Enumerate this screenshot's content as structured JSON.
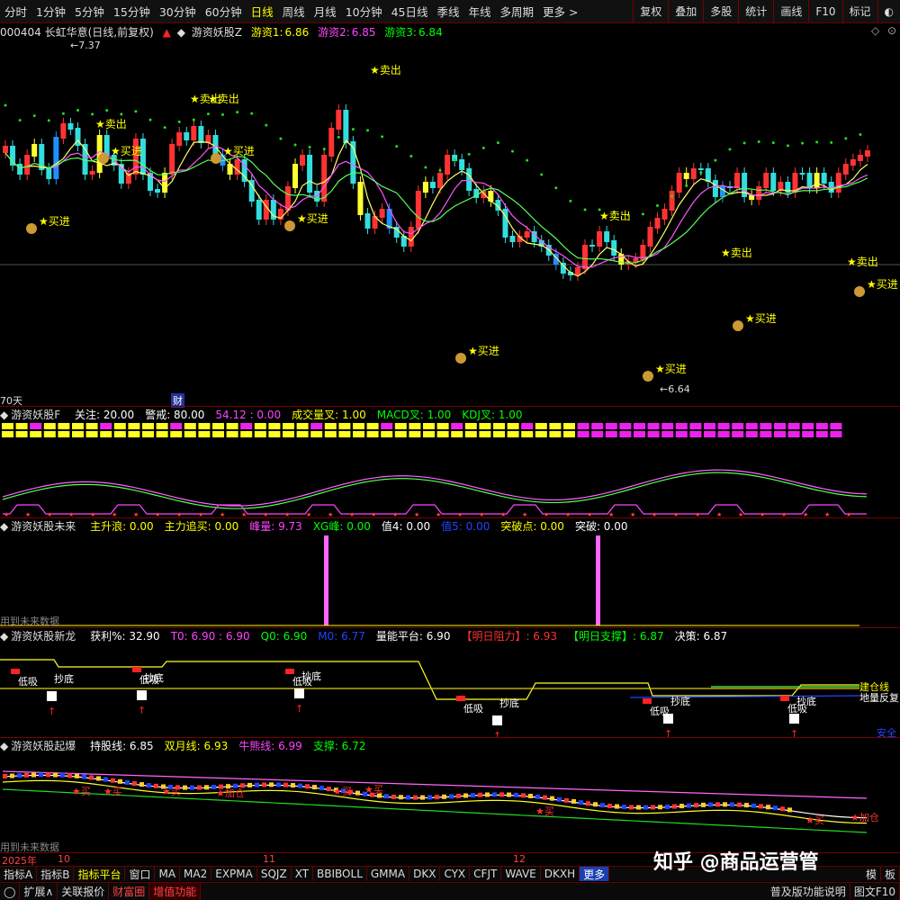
{
  "toolbar": {
    "periods": [
      "分时",
      "1分钟",
      "5分钟",
      "15分钟",
      "30分钟",
      "60分钟",
      "日线",
      "周线",
      "月线",
      "10分钟",
      "45日线",
      "季线",
      "年线",
      "多周期",
      "更多 >"
    ],
    "active_index": 6,
    "right": [
      "复权",
      "叠加",
      "多股",
      "统计",
      "画线",
      "F10",
      "标记",
      "◐"
    ]
  },
  "stock": {
    "title": "000404 长虹华意(日线,前复权)",
    "indicator": "游资妖股Z",
    "v1_label": "游资1:",
    "v1": "6.86",
    "v2_label": "游资2:",
    "v2": "6.85",
    "v3_label": "游资3:",
    "v3": "6.84",
    "high": "7.37",
    "low": "6.64",
    "days": "70天",
    "cai": "财"
  },
  "signals": {
    "sell": "卖出",
    "buy": "买进"
  },
  "panel2": {
    "name": "游资妖股F",
    "items": [
      {
        "t": "关注: 20.00",
        "c": "#ffffff"
      },
      {
        "t": "警戒: 80.00",
        "c": "#ffffff"
      },
      {
        "t": "54.12 : 0.00",
        "c": "#ff44ff"
      },
      {
        "t": "成交量叉: 1.00",
        "c": "#ffff00"
      },
      {
        "t": "MACD叉: 1.00",
        "c": "#00ff00"
      },
      {
        "t": "KDJ叉: 1.00",
        "c": "#00ff00"
      }
    ]
  },
  "panel3": {
    "name": "游资妖股未来",
    "items": [
      {
        "t": "主升浪: 0.00",
        "c": "#ffff00"
      },
      {
        "t": "主力追买: 0.00",
        "c": "#ffff00"
      },
      {
        "t": "峰量: 9.73",
        "c": "#ff44ff"
      },
      {
        "t": "XG峰: 0.00",
        "c": "#00ff00"
      },
      {
        "t": "值4: 0.00",
        "c": "#ffffff"
      },
      {
        "t": "值5: 0.00",
        "c": "#2244ff"
      },
      {
        "t": "突破点: 0.00",
        "c": "#ffff00"
      },
      {
        "t": "突破: 0.00",
        "c": "#ffffff"
      }
    ],
    "future": "用到未来数据"
  },
  "panel4": {
    "name": "游资妖股新龙",
    "items": [
      {
        "t": "获利%: 32.90",
        "c": "#ffffff"
      },
      {
        "t": "T0: 6.90 : 6.90",
        "c": "#ff44ff"
      },
      {
        "t": "Q0: 6.90",
        "c": "#00ff00"
      },
      {
        "t": "M0: 6.77",
        "c": "#2244ff"
      },
      {
        "t": "量能平台: 6.90",
        "c": "#ffffff"
      },
      {
        "t": "【明日阻力】: 6.93",
        "c": "#ff3333"
      },
      {
        "t": "【明日支撑】: 6.87",
        "c": "#00ff00"
      },
      {
        "t": "决策: 6.87",
        "c": "#ffffff"
      }
    ],
    "low_buy": "低吸",
    "bottom": "抄底",
    "jiancang": "建仓线",
    "ladder": "地量反复",
    "anquan": "安全"
  },
  "panel5": {
    "name": "游资妖股起爆",
    "items": [
      {
        "t": "持股线: 6.85",
        "c": "#ffffff"
      },
      {
        "t": "双月线: 6.93",
        "c": "#ffff00"
      },
      {
        "t": "牛熊线: 6.99",
        "c": "#ff44ff"
      },
      {
        "t": "支撑: 6.72",
        "c": "#00ff00"
      }
    ],
    "buy": "买",
    "add": "加仓",
    "future": "用到未来数据"
  },
  "axis": {
    "year": "2025年",
    "m10": "10",
    "m11": "11",
    "m12": "12"
  },
  "bottom1": [
    "指标A",
    "指标B",
    "指标平台",
    "窗口",
    "MA",
    "MA2",
    "EXPMA",
    "SQJZ",
    "XT",
    "BBIBOLL",
    "GMMA",
    "DKX",
    "CYX",
    "CFJT",
    "WAVE",
    "DKXH",
    "更多"
  ],
  "bottom1_right": [
    "模",
    "板"
  ],
  "bottom2": [
    "◯",
    "扩展∧",
    "关联报价",
    "财富圈",
    "增值功能"
  ],
  "bottom2_right": [
    "普及版功能说明",
    "图文F10"
  ],
  "watermark": "知乎 @商品运营管"
}
